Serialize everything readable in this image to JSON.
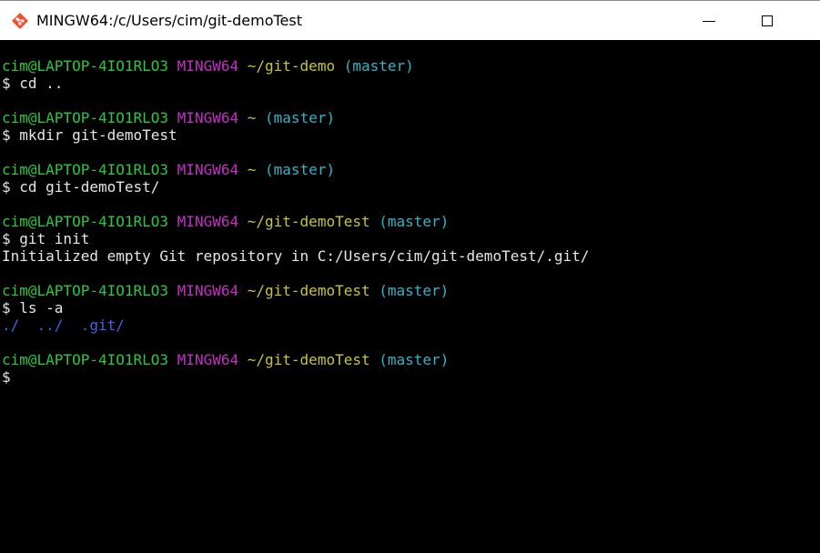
{
  "window": {
    "title": "MINGW64:/c/Users/cim/git-demoTest"
  },
  "colors": {
    "user_host": "#2bc741",
    "system": "#c330c3",
    "path": "#c7c43a",
    "branch": "#32b4c9",
    "directory": "#3f64e8",
    "text": "#e6e6e6",
    "background": "#000000"
  },
  "terminal": {
    "blocks": [
      {
        "prompt": {
          "user": "cim@LAPTOP-4IO1RLO3",
          "system": "MINGW64",
          "path": "~/git-demo",
          "branch": "(master)"
        },
        "command": "$ cd .."
      },
      {
        "prompt": {
          "user": "cim@LAPTOP-4IO1RLO3",
          "system": "MINGW64",
          "path": "~",
          "branch": "(master)"
        },
        "command": "$ mkdir git-demoTest"
      },
      {
        "prompt": {
          "user": "cim@LAPTOP-4IO1RLO3",
          "system": "MINGW64",
          "path": "~",
          "branch": "(master)"
        },
        "command": "$ cd git-demoTest/"
      },
      {
        "prompt": {
          "user": "cim@LAPTOP-4IO1RLO3",
          "system": "MINGW64",
          "path": "~/git-demoTest",
          "branch": "(master)"
        },
        "command": "$ git init",
        "output": "Initialized empty Git repository in C:/Users/cim/git-demoTest/.git/"
      },
      {
        "prompt": {
          "user": "cim@LAPTOP-4IO1RLO3",
          "system": "MINGW64",
          "path": "~/git-demoTest",
          "branch": "(master)"
        },
        "command": "$ ls -a",
        "listing": [
          "./",
          "../",
          ".git/"
        ]
      },
      {
        "prompt": {
          "user": "cim@LAPTOP-4IO1RLO3",
          "system": "MINGW64",
          "path": "~/git-demoTest",
          "branch": "(master)"
        },
        "command": "$"
      }
    ]
  }
}
